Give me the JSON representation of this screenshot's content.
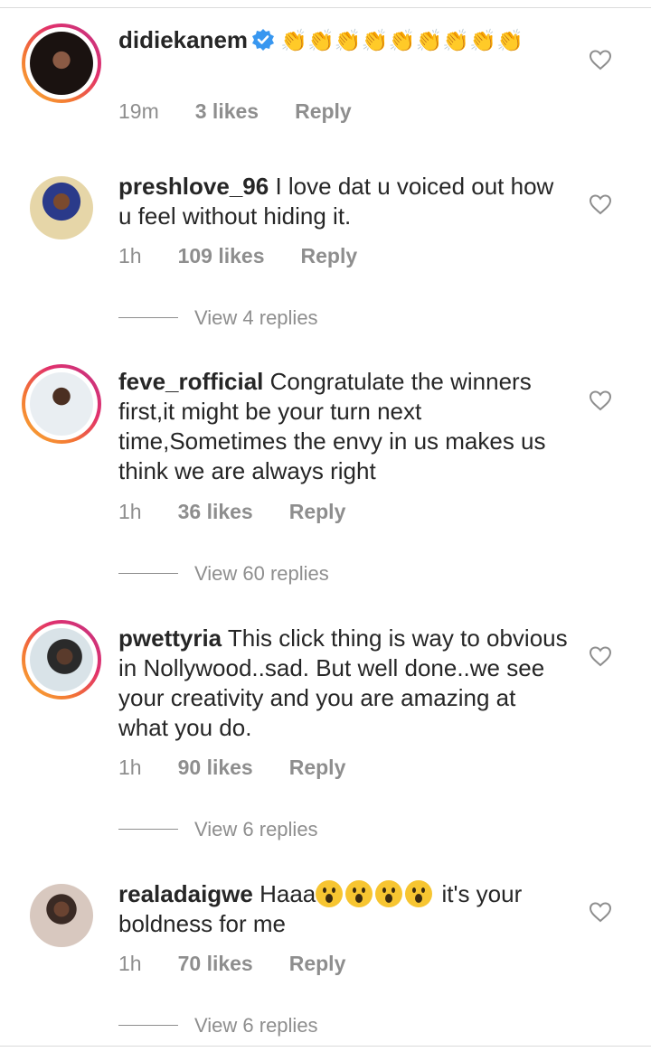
{
  "comments": [
    {
      "username": "didiekanem",
      "verified": true,
      "story_ring": true,
      "text": "👏👏👏👏👏👏👏👏👏",
      "time": "19m",
      "likes": "3 likes",
      "reply": "Reply",
      "view_replies": ""
    },
    {
      "username": "preshlove_96",
      "verified": false,
      "story_ring": false,
      "text": "I love dat u voiced out how u feel without hiding it.",
      "time": "1h",
      "likes": "109 likes",
      "reply": "Reply",
      "view_replies": "View 4 replies"
    },
    {
      "username": "feve_rofficial",
      "verified": false,
      "story_ring": true,
      "text": "Congratulate the winners first,it might be your turn next time,Sometimes the envy in us makes us think we are always right",
      "time": "1h",
      "likes": "36 likes",
      "reply": "Reply",
      "view_replies": "View 60 replies"
    },
    {
      "username": "pwettyria",
      "verified": false,
      "story_ring": true,
      "text": "This click thing is way to obvious in Nollywood..sad. But well done..we see your creativity and you are amazing at what you do.",
      "time": "1h",
      "likes": "90 likes",
      "reply": "Reply",
      "view_replies": "View 6 replies"
    },
    {
      "username": "realadaigwe",
      "verified": false,
      "story_ring": false,
      "text_before": "Haaa",
      "text_after": "it's your boldness for me",
      "time": "1h",
      "likes": "70 likes",
      "reply": "Reply",
      "view_replies": "View 6 replies"
    }
  ],
  "colors": {
    "text": "#262626",
    "muted": "#8e8e8e",
    "verified": "#3897f0",
    "story_ring_start": "#f9b233",
    "story_ring_end": "#c13584"
  },
  "icons": [
    "heart-outline-icon",
    "verified-badge-icon",
    "clapping-hands-emoji",
    "astonished-face-emoji"
  ]
}
